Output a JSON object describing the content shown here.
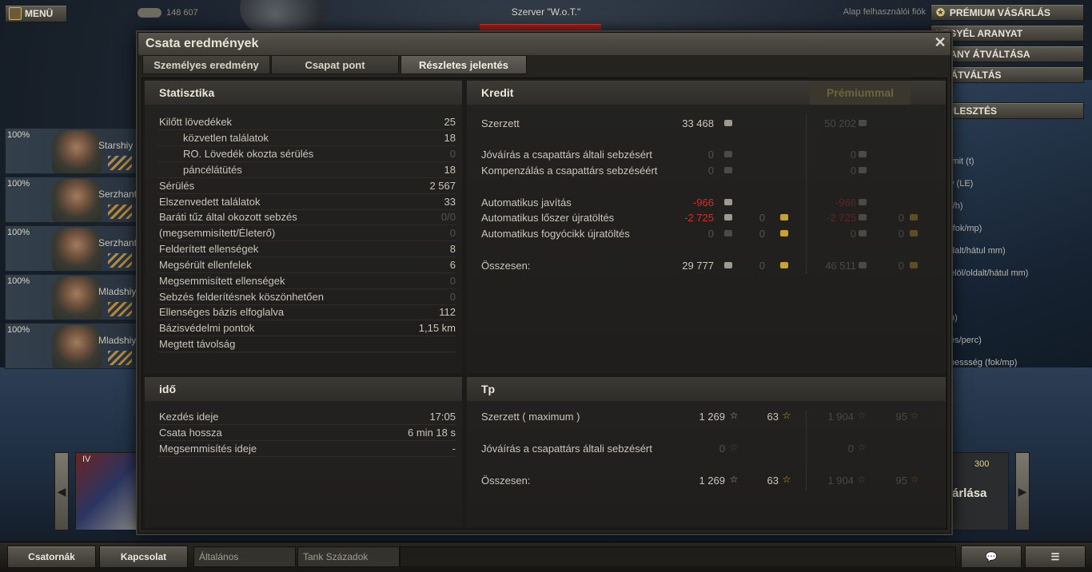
{
  "top_bar": {
    "menu_label": "MENÜ",
    "credits": "148 607",
    "server": "Szerver \"W.o.T.\"",
    "account_type": "Alap felhasználói fiók"
  },
  "right_buttons": {
    "premium": "PRÉMIUM VÁSÁRLÁS",
    "gold": "VEGYÉL ARANYAT",
    "exchange": "ARANY ÁTVÁLTÁSA",
    "xp": "TP ÁTVÁLTÁS",
    "research": "FEJLESZTÉS"
  },
  "right_stats": [
    "imit (t)",
    "y (LE)",
    "r/h)",
    "(fok/mp)",
    "dalt/hátul mm)",
    "elöl/oldalt/hátul mm)",
    "h)",
    "és/perc)",
    "bessség (fok/mp)"
  ],
  "crew": [
    {
      "pct": "100%",
      "name": "Starshiy"
    },
    {
      "pct": "100%",
      "name": "Serzhant"
    },
    {
      "pct": "100%",
      "name": "Serzhant"
    },
    {
      "pct": "100%",
      "name": "Mladshiy"
    },
    {
      "pct": "100%",
      "name": "Mladshiy"
    }
  ],
  "carousel": {
    "tier": "IV",
    "price": "300",
    "buy_label": "árlása"
  },
  "bottom_bar": {
    "channels": "Csatornák",
    "contacts": "Kapcsolat",
    "chat_general": "Általános",
    "chat_companies": "Tank Századok"
  },
  "modal": {
    "title": "Csata eredmények",
    "tabs": [
      "Személyes eredmény",
      "Csapat pont",
      "Részletes jelentés"
    ],
    "active_tab": 2
  },
  "statistics": {
    "header": "Statisztika",
    "rows": [
      {
        "label": "Kilőtt lövedékek",
        "value": "25"
      },
      {
        "label": "közvetlen találatok",
        "value": "18"
      },
      {
        "label": "RO. Lövedék okozta sérülés",
        "value": "0"
      },
      {
        "label": "páncélátütés",
        "value": "18"
      },
      {
        "label": "Sérülés",
        "value": "2 567"
      },
      {
        "label": "Elszenvedett találatok",
        "value": "33"
      },
      {
        "label": "Baráti tűz által okozott sebzés",
        "value": "0/0"
      },
      {
        "label": "(megsemmisített/Életerő)",
        "value": "0"
      },
      {
        "label": "Felderített ellenségek",
        "value": "8"
      },
      {
        "label": "Megsérült ellenfelek",
        "value": "6"
      },
      {
        "label": "Megsemmisített ellenségek",
        "value": "0"
      },
      {
        "label": "Sebzés felderítésnek köszönhetően",
        "value": "0"
      },
      {
        "label": "Ellenséges bázis elfoglalva",
        "value": "112"
      },
      {
        "label": "Bázisvédelmi pontok",
        "value": "1,15 km"
      },
      {
        "label": "Megtett távolság",
        "value": ""
      }
    ]
  },
  "credit": {
    "header": "Kredit",
    "premium_header": "Prémiummal",
    "rows": [
      {
        "label": "Szerzett",
        "credit": "33 468",
        "gold": "",
        "p_credit": "50 202",
        "p_gold": ""
      },
      {
        "label": "Jóváírás a csapattárs általi sebzésért",
        "credit": "0",
        "gold": "",
        "p_credit": "0",
        "p_gold": ""
      },
      {
        "label": "Kompenzálás a csapattárs sebzéséért",
        "credit": "0",
        "gold": "",
        "p_credit": "0",
        "p_gold": ""
      },
      {
        "label": "Automatikus javítás",
        "credit": "-966",
        "gold": "",
        "p_credit": "-966",
        "p_gold": ""
      },
      {
        "label": "Automatikus lőszer újratöltés",
        "credit": "-2 725",
        "gold": "0",
        "p_credit": "-2 725",
        "p_gold": "0"
      },
      {
        "label": "Automatikus fogyócikk újratöltés",
        "credit": "0",
        "gold": "0",
        "p_credit": "0",
        "p_gold": "0"
      },
      {
        "label": "Összesen:",
        "credit": "29 777",
        "gold": "0",
        "p_credit": "46 511",
        "p_gold": "0"
      }
    ]
  },
  "time": {
    "header": "idő",
    "rows": [
      {
        "label": "Kezdés ideje",
        "value": "17:05"
      },
      {
        "label": "Csata hossza",
        "value": "6 min 18 s"
      },
      {
        "label": "Megsemmisítés ideje",
        "value": "-"
      }
    ]
  },
  "xp": {
    "header": "Tp",
    "rows": [
      {
        "label": "Szerzett ( maximum )",
        "xp": "1 269",
        "fxp": "63",
        "p_xp": "1 904",
        "p_fxp": "95"
      },
      {
        "label": "Jóváírás a csapattárs általi sebzésért",
        "xp": "0",
        "fxp": "",
        "p_xp": "0",
        "p_fxp": ""
      },
      {
        "label": "Összesen:",
        "xp": "1 269",
        "fxp": "63",
        "p_xp": "1 904",
        "p_fxp": "95"
      }
    ]
  },
  "colors": {
    "negative": "#d12e26",
    "gold": "#c9a233",
    "dim": "#55534c"
  }
}
